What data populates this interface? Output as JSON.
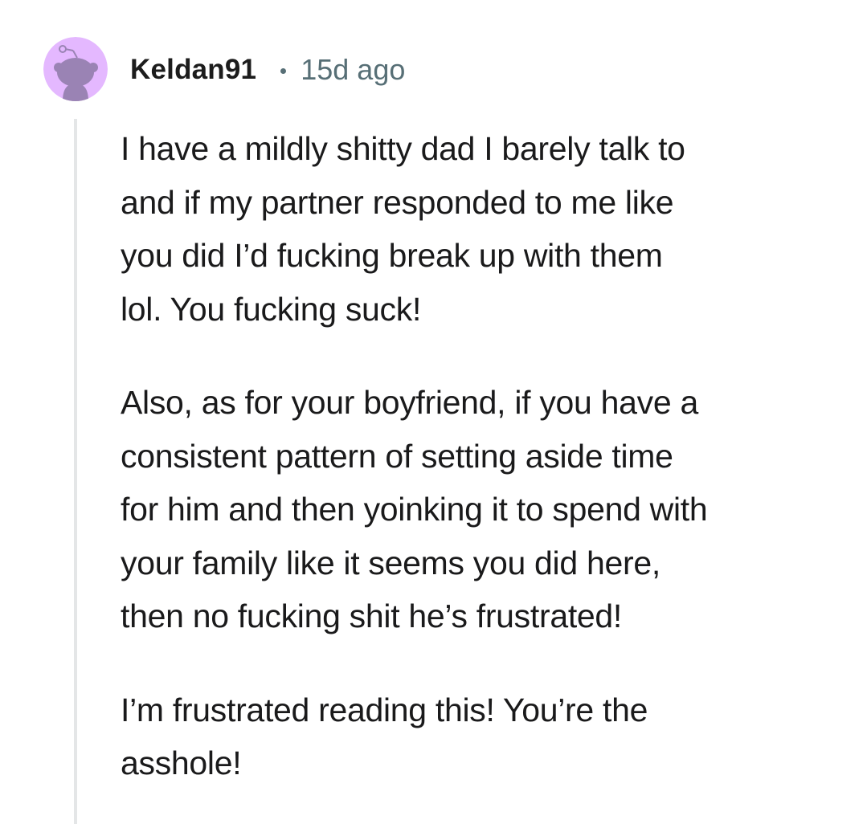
{
  "comment": {
    "author": "Keldan91",
    "separator": "•",
    "timestamp": "15d ago",
    "avatar_icon": "snoo-avatar-icon",
    "colors": {
      "avatar_bg": "#e4b8ff",
      "avatar_snoo": "#9a83b4",
      "meta_text": "#576f76",
      "thread_line": "#e4e6e7"
    },
    "paragraphs": [
      "I have a mildly shitty dad I barely talk to\nand if my partner responded to me like\nyou did I’d fucking break up with them\nlol. You fucking suck!",
      "Also, as for your boyfriend, if you have a\nconsistent pattern of setting aside time\nfor him and then yoinking it to spend with\nyour family like it seems you did here,\nthen no fucking shit he’s frustrated!",
      "I’m frustrated reading this! You’re the\nasshole!"
    ]
  }
}
